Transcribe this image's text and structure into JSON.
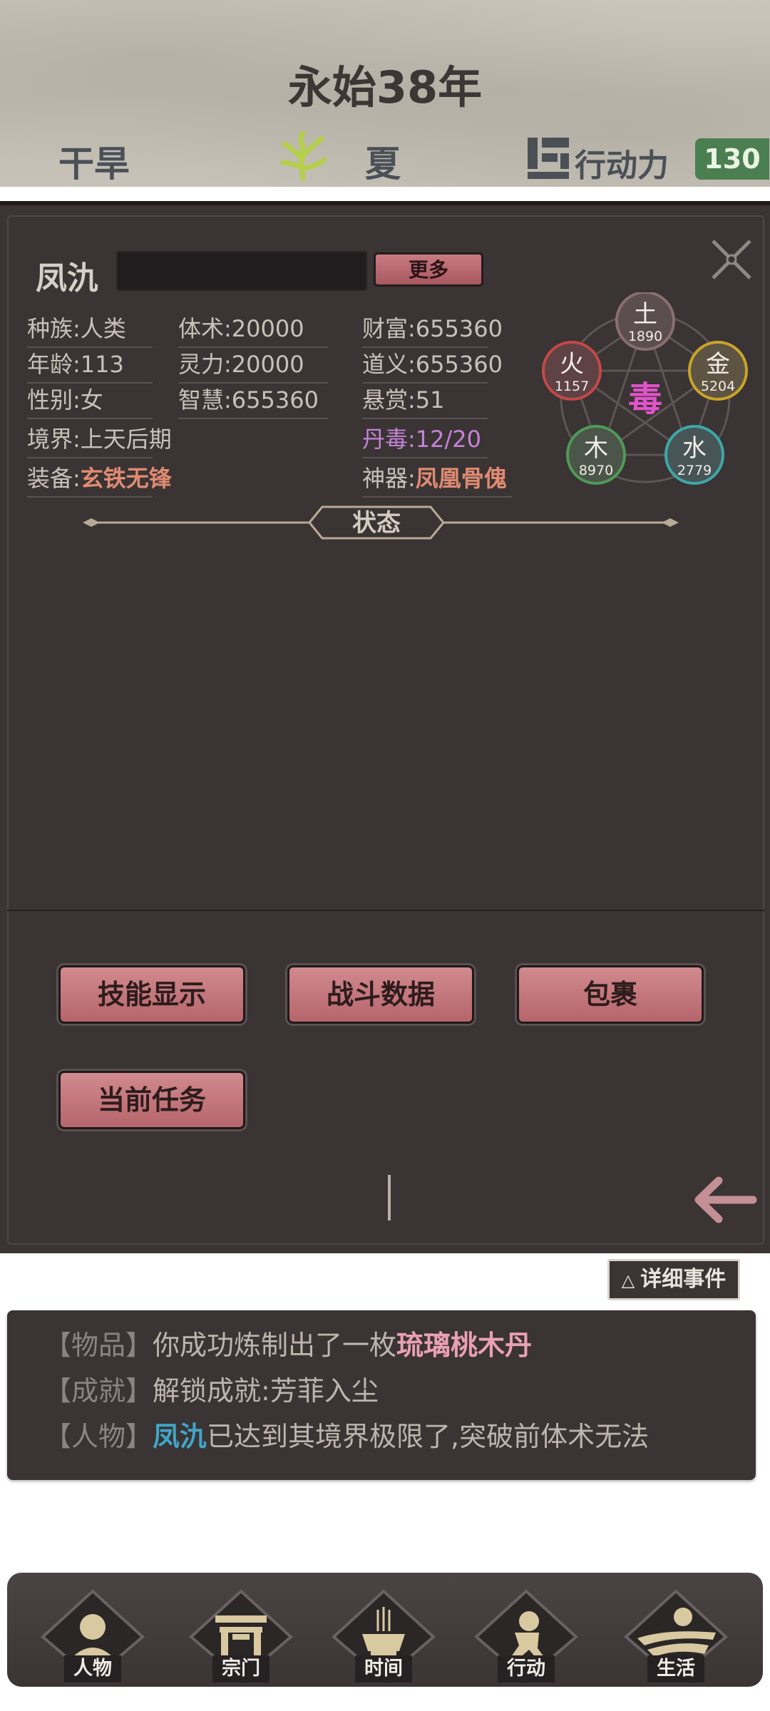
{
  "header": {
    "year": "永始38年",
    "weather": "干旱",
    "season": "夏",
    "action_label": "行动力",
    "action_value": "130"
  },
  "character": {
    "name": "凤氿",
    "more_label": "更多",
    "stats": {
      "race": "种族:人类",
      "age": "年龄:113",
      "gender": "性别:女",
      "realm": "境界:上天后期",
      "equip_label": "装备:",
      "equip_value": "玄铁无锋",
      "body": "体术:20000",
      "spirit": "灵力:20000",
      "wisdom": "智慧:655360",
      "wealth": "财富:655360",
      "justice": "道义:655360",
      "bounty": "悬赏:51",
      "poison": "丹毒:12/20",
      "artifact_label": "神器:",
      "artifact_value": "凤凰骨傀"
    },
    "status_title": "状态",
    "elements": {
      "center": "毒",
      "earth": {
        "name": "土",
        "value": "1890",
        "color": "#8a6f6f"
      },
      "fire": {
        "name": "火",
        "value": "1157",
        "color": "#c44848"
      },
      "metal": {
        "name": "金",
        "value": "5204",
        "color": "#c9a428"
      },
      "wood": {
        "name": "木",
        "value": "8970",
        "color": "#4f9a58"
      },
      "water": {
        "name": "水",
        "value": "2779",
        "color": "#3ea7a8"
      }
    }
  },
  "actions": {
    "skills": "技能显示",
    "battle_data": "战斗数据",
    "bag": "包裹",
    "current_task": "当前任务"
  },
  "events": {
    "detail_button": "详细事件",
    "lines": [
      {
        "tag": "【物品】",
        "text": "你成功炼制出了一枚",
        "highlight": "琉璃桃木丹"
      },
      {
        "tag": "【成就】",
        "text": "解锁成就:芳菲入尘"
      },
      {
        "tag": "【人物】",
        "highlight": "凤氿",
        "text": "已达到其境界极限了,突破前体术无法"
      }
    ]
  },
  "nav": {
    "person": "人物",
    "sect": "宗门",
    "time": "时间",
    "action": "行动",
    "life": "生活"
  }
}
